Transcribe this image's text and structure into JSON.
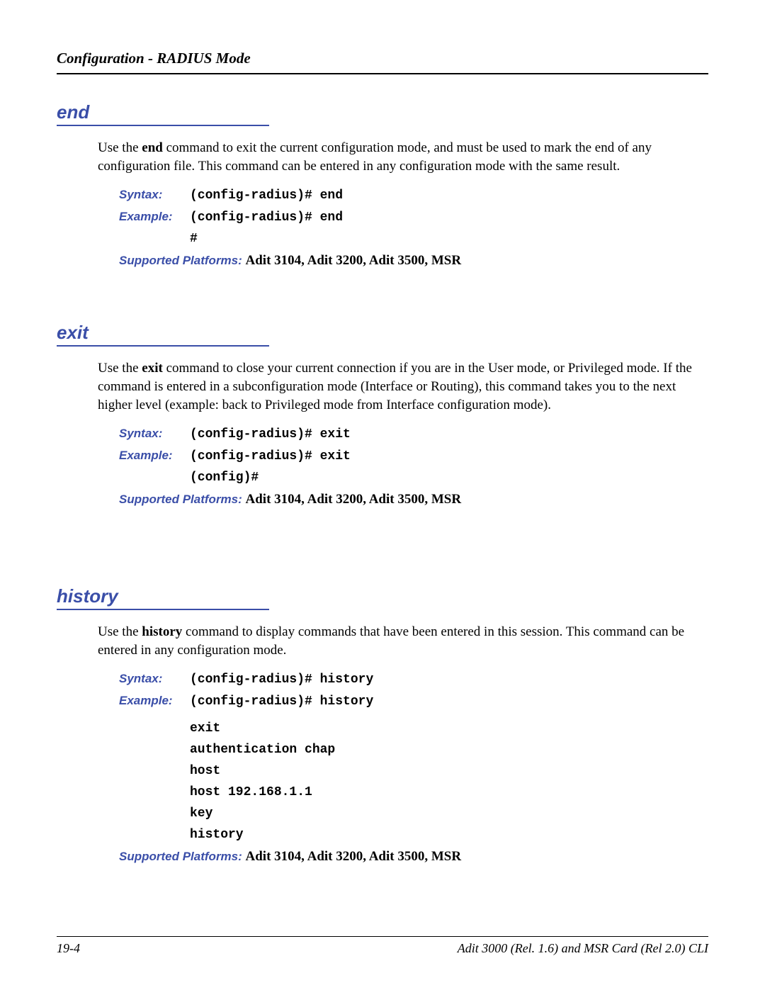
{
  "header": {
    "title": "Configuration - RADIUS Mode"
  },
  "sections": {
    "end": {
      "title": "end",
      "description_prefix": "Use the ",
      "description_bold": "end",
      "description_suffix": " command to exit the current configuration mode, and must be used to mark the end of any configuration file.  This command can be entered in any configuration mode with the same result.",
      "syntax_label": "Syntax:",
      "syntax_code": "(config-radius)# end",
      "example_label": "Example:",
      "example_code": "(config-radius)# end",
      "example_cont1": "#",
      "platforms_label": "Supported Platforms:  ",
      "platforms_value": "Adit 3104, Adit 3200, Adit 3500, MSR"
    },
    "exit": {
      "title": "exit",
      "description_prefix": "Use the ",
      "description_bold": "exit",
      "description_suffix": " command to close your current connection if you are in the User mode, or Privileged mode. If the command is entered in a subconfiguration mode (Interface or Routing), this command takes you to the next higher level (example: back to Privileged mode from Interface configuration mode).",
      "syntax_label": "Syntax:",
      "syntax_code": "(config-radius)# exit",
      "example_label": "Example:",
      "example_code": "(config-radius)# exit",
      "example_cont1": "(config)#",
      "platforms_label": "Supported Platforms:  ",
      "platforms_value": "Adit 3104, Adit 3200, Adit 3500, MSR"
    },
    "history": {
      "title": "history",
      "description_prefix": "Use the ",
      "description_bold": "history",
      "description_suffix": " command to display commands that have been entered in this session.  This command can be entered in any configuration mode.",
      "syntax_label": "Syntax:",
      "syntax_code": "(config-radius)# history",
      "example_label": "Example:",
      "example_code": "(config-radius)# history",
      "example_cont1": "exit",
      "example_cont2": "authentication chap",
      "example_cont3": "host",
      "example_cont4": "host 192.168.1.1",
      "example_cont5": "key",
      "example_cont6": "history",
      "platforms_label": "Supported Platforms:  ",
      "platforms_value": "Adit 3104, Adit 3200, Adit 3500, MSR"
    }
  },
  "footer": {
    "page_number": "19-4",
    "doc_title": "Adit 3000 (Rel. 1.6) and MSR Card (Rel 2.0) CLI"
  }
}
